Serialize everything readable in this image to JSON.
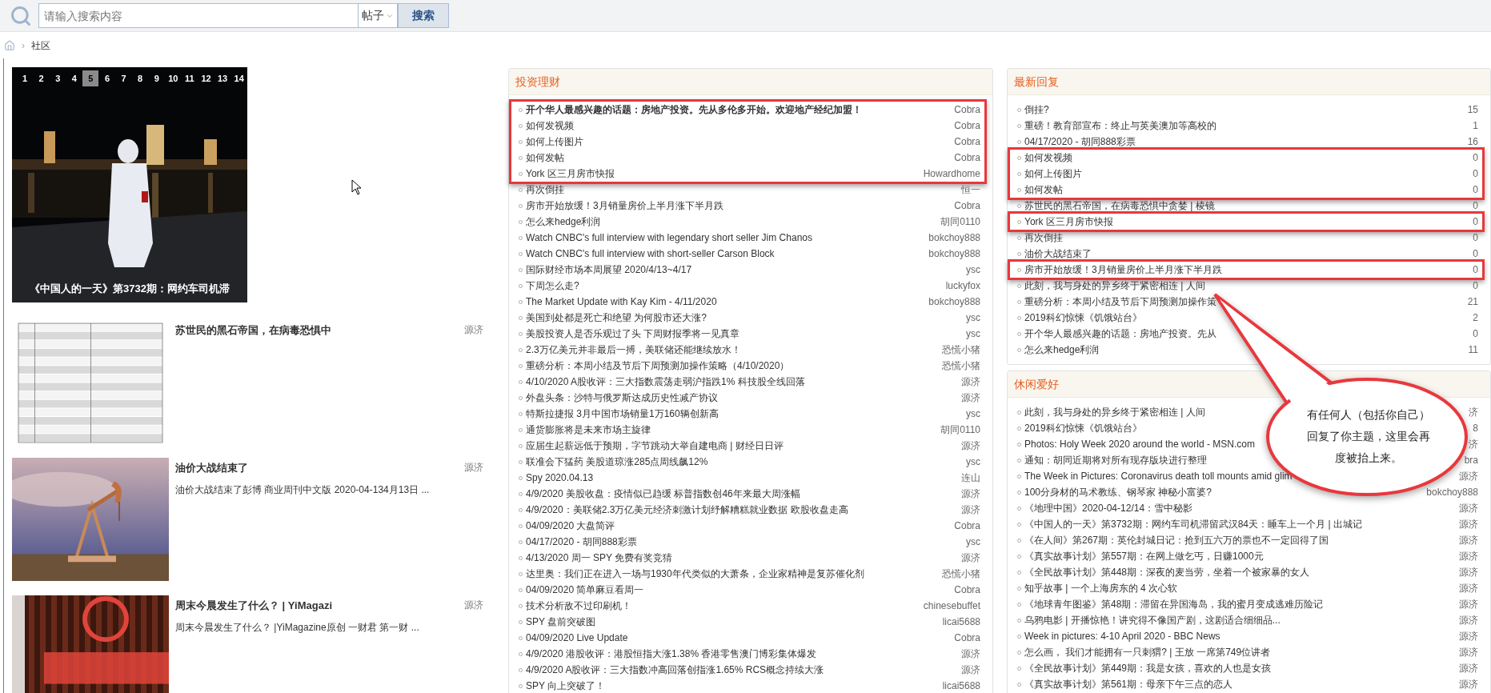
{
  "search": {
    "placeholder": "请输入搜索内容",
    "scope": "帖子",
    "button": "搜索"
  },
  "breadcrumb": {
    "separator": "›",
    "items": [
      "社区"
    ]
  },
  "slideshow": {
    "pages": [
      {
        "label": "1",
        "selected": false
      },
      {
        "label": "2",
        "selected": false
      },
      {
        "label": "3",
        "selected": false
      },
      {
        "label": "4",
        "selected": false
      },
      {
        "label": "5",
        "selected": true
      },
      {
        "label": "6",
        "selected": false
      },
      {
        "label": "7",
        "selected": false
      },
      {
        "label": "8",
        "selected": false
      },
      {
        "label": "9",
        "selected": false
      },
      {
        "label": "10",
        "selected": false
      },
      {
        "label": "11",
        "selected": false
      },
      {
        "label": "12",
        "selected": false
      },
      {
        "label": "13",
        "selected": false
      },
      {
        "label": "14",
        "selected": false
      }
    ],
    "caption": "《中国人的一天》第3732期：网约车司机滞"
  },
  "featured": [
    {
      "title": "苏世民的黑石帝国，在病毒恐惧中",
      "author": "源济"
    },
    {
      "title": "油价大战结束了",
      "author": "源济",
      "excerpt": "油价大战结束了彭博 商业周刊中文版 2020-04-134月13日 ..."
    },
    {
      "title": "周末今晨发生了什么？ | YiMagazi",
      "author": "源济",
      "excerpt": "周末今晨发生了什么？ |YiMagazine原创 一财君 第一财 ..."
    }
  ],
  "panels": [
    {
      "title": "投资理财",
      "rows": [
        {
          "title": "开个华人最感兴趣的话题：房地产投资。先从多伦多开始。欢迎地产经纪加盟！",
          "author": "Cobra",
          "bold": true,
          "highlighted": true
        },
        {
          "title": "如何发视频",
          "author": "Cobra",
          "bold": false,
          "highlighted": true
        },
        {
          "title": "如何上传图片",
          "author": "Cobra",
          "bold": false,
          "highlighted": true
        },
        {
          "title": "如何发帖",
          "author": "Cobra",
          "bold": false,
          "highlighted": true
        },
        {
          "title": "York 区三月房市快报",
          "author": "Howardhome",
          "bold": false,
          "highlighted": true
        },
        {
          "title": "再次倒挂",
          "author": "恒一",
          "bold": false,
          "highlighted": false
        },
        {
          "title": "房市开始放缓！3月销量房价上半月涨下半月跌",
          "author": "Cobra",
          "bold": false,
          "highlighted": false
        },
        {
          "title": "怎么来hedge利润",
          "author": "胡同0110",
          "bold": false,
          "highlighted": false
        },
        {
          "title": "Watch CNBC's full interview with legendary short seller Jim Chanos",
          "author": "bokchoy888",
          "bold": false,
          "highlighted": false
        },
        {
          "title": "Watch CNBC's full interview with short-seller Carson Block",
          "author": "bokchoy888",
          "bold": false,
          "highlighted": false
        },
        {
          "title": "国际财经市场本周展望 2020/4/13~4/17",
          "author": "ysc",
          "bold": false,
          "highlighted": false
        },
        {
          "title": "下周怎么走?",
          "author": "luckyfox",
          "bold": false,
          "highlighted": false
        },
        {
          "title": "The Market Update with Kay Kim - 4/11/2020",
          "author": "bokchoy888",
          "bold": false,
          "highlighted": false
        },
        {
          "title": "美国到处都是死亡和绝望 为何股市还大涨?",
          "author": "ysc",
          "bold": false,
          "highlighted": false
        },
        {
          "title": "美股投资人是否乐观过了头 下周财报季将一见真章",
          "author": "ysc",
          "bold": false,
          "highlighted": false
        },
        {
          "title": "2.3万亿美元并非最后一搏，美联储还能继续放水！",
          "author": "恐慌小猪",
          "bold": false,
          "highlighted": false
        },
        {
          "title": "重磅分析：本周小结及节后下周预测加操作策略（4/10/2020）",
          "author": "恐慌小猪",
          "bold": false,
          "highlighted": false
        },
        {
          "title": "4/10/2020 A股收评：三大指数震荡走弱沪指跌1% 科技股全线回落",
          "author": "源济",
          "bold": false,
          "highlighted": false
        },
        {
          "title": "外盘头条：沙特与俄罗斯达成历史性减产协议",
          "author": "源济",
          "bold": false,
          "highlighted": false
        },
        {
          "title": "特斯拉捷报 3月中国市场销量1万160辆创新高",
          "author": "ysc",
          "bold": false,
          "highlighted": false
        },
        {
          "title": "通货膨胀将是未来市场主旋律",
          "author": "胡同0110",
          "bold": false,
          "highlighted": false
        },
        {
          "title": "应届生起薪远低于预期，字节跳动大举自建电商 | 财经日日评",
          "author": "源济",
          "bold": false,
          "highlighted": false
        },
        {
          "title": "联准会下猛药 美股道琼涨285点周线飙12%",
          "author": "ysc",
          "bold": false,
          "highlighted": false
        },
        {
          "title": "Spy 2020.04.13",
          "author": "连山",
          "bold": false,
          "highlighted": false
        },
        {
          "title": "4/9/2020 美股收盘：疫情似已趋缓 标普指数创46年来最大周涨幅",
          "author": "源济",
          "bold": false,
          "highlighted": false
        },
        {
          "title": "4/9/2020：美联储2.3万亿美元经济刺激计划纾解糟糕就业数据 欧股收盘走高",
          "author": "源济",
          "bold": false,
          "highlighted": false
        },
        {
          "title": "04/09/2020 大盘简评",
          "author": "Cobra",
          "bold": false,
          "highlighted": false
        },
        {
          "title": "04/17/2020 - 胡同888彩票",
          "author": "ysc",
          "bold": false,
          "highlighted": false
        },
        {
          "title": "4/13/2020 周一 SPY 免费有奖竞猜",
          "author": "源济",
          "bold": false,
          "highlighted": false
        },
        {
          "title": "达里奥：我们正在进入一场与1930年代类似的大萧条，企业家精神是复苏催化剂",
          "author": "恐慌小猪",
          "bold": false,
          "highlighted": false
        },
        {
          "title": "04/09/2020 简单麻豆看周一",
          "author": "Cobra",
          "bold": false,
          "highlighted": false
        },
        {
          "title": "技术分析敌不过印刷机！",
          "author": "chinesebuffet",
          "bold": false,
          "highlighted": false
        },
        {
          "title": "SPY 盘前突破图",
          "author": "licai5688",
          "bold": false,
          "highlighted": false
        },
        {
          "title": "04/09/2020 Live Update",
          "author": "Cobra",
          "bold": false,
          "highlighted": false
        },
        {
          "title": "4/9/2020 港股收评：港股恒指大涨1.38% 香港零售澳门博彩集体爆发",
          "author": "源济",
          "bold": false,
          "highlighted": false
        },
        {
          "title": "4/9/2020 A股收评：三大指数冲高回落创指涨1.65% RCS概念持续大涨",
          "author": "源济",
          "bold": false,
          "highlighted": false
        },
        {
          "title": "SPY 向上突破了！",
          "author": "licai5688",
          "bold": false,
          "highlighted": false
        }
      ]
    },
    {
      "title": "最新回复",
      "rows": [
        {
          "title": "倒挂?",
          "count": "15",
          "highlighted": false
        },
        {
          "title": "重磅！教育部宣布：终止与英美澳加等高校的",
          "count": "1",
          "highlighted": false
        },
        {
          "title": "04/17/2020 - 胡同888彩票",
          "count": "16",
          "highlighted": false
        },
        {
          "title": "如何发视频",
          "count": "0",
          "highlighted": true
        },
        {
          "title": "如何上传图片",
          "count": "0",
          "highlighted": true
        },
        {
          "title": "如何发帖",
          "count": "0",
          "highlighted": true
        },
        {
          "title": "苏世民的黑石帝国，在病毒恐惧中贪婪 | 棱镜",
          "count": "0",
          "highlighted": false
        },
        {
          "title": "York 区三月房市快报",
          "count": "0",
          "highlighted": true
        },
        {
          "title": "再次倒挂",
          "count": "0",
          "highlighted": false
        },
        {
          "title": "油价大战结束了",
          "count": "0",
          "highlighted": false
        },
        {
          "title": "房市开始放缓！3月销量房价上半月涨下半月跌",
          "count": "0",
          "highlighted": true
        },
        {
          "title": "此刻，我与身处的异乡终于紧密相连 | 人间",
          "count": "0",
          "highlighted": false
        },
        {
          "title": "重磅分析：本周小结及节后下周预测加操作策",
          "count": "21",
          "highlighted": false
        },
        {
          "title": "2019科幻惊悚《饥饿站台》",
          "count": "2",
          "highlighted": false
        },
        {
          "title": "开个华人最感兴趣的话题：房地产投资。先从",
          "count": "0",
          "highlighted": false
        },
        {
          "title": "怎么来hedge利润",
          "count": "11",
          "highlighted": false
        }
      ]
    },
    {
      "title": "休闲爱好",
      "rows": [
        {
          "title": "此刻，我与身处的异乡终于紧密相连 | 人间",
          "author": "济"
        },
        {
          "title": "2019科幻惊悚《饥饿站台》",
          "author": "8"
        },
        {
          "title": "Photos: Holy Week 2020 around the world - MSN.com",
          "author": "济"
        },
        {
          "title": "通知：胡同近期将对所有现存版块进行整理",
          "author": "bra"
        },
        {
          "title": "The Week in Pictures: Coronavirus death toll mounts amid glim",
          "author": "源济"
        },
        {
          "title": "100分身材的马术教练、钢琴家 神秘小富婆?",
          "author": "bokchoy888"
        },
        {
          "title": "《地理中国》2020-04-12/14：雪中秘影",
          "author": "源济"
        },
        {
          "title": "《中国人的一天》第3732期：网约车司机滞留武汉84天：睡车上一个月 | 出城记",
          "author": "源济"
        },
        {
          "title": "《在人间》第267期：英伦封城日记：抢到五六万的票也不一定回得了国",
          "author": "源济"
        },
        {
          "title": "《真实故事计划》第557期：在网上做乞丐，日赚1000元",
          "author": "源济"
        },
        {
          "title": "《全民故事计划》第448期：深夜的麦当劳，坐着一个被家暴的女人",
          "author": "源济"
        },
        {
          "title": "知乎故事 | 一个上海房东的 4 次心软",
          "author": "源济"
        },
        {
          "title": "《地球青年图鉴》第48期：滞留在异国海岛，我的蜜月变成逃难历险记",
          "author": "源济"
        },
        {
          "title": "乌鸦电影 | 开播惊艳！讲究得不像国产剧，这剧适合细细品...",
          "author": "源济"
        },
        {
          "title": "Week in pictures: 4-10 April 2020 - BBC News",
          "author": "源济"
        },
        {
          "title": "怎么画， 我们才能拥有一只刺猬? | 王放 一席第749位讲者",
          "author": "源济"
        },
        {
          "title": "《全民故事计划》第449期：我是女孩，喜欢的人也是女孩",
          "author": "源济"
        },
        {
          "title": "《真实故事计划》第561期：母亲下午三点的恋人",
          "author": "源济"
        }
      ]
    }
  ],
  "callout": {
    "text": "有任何人（包括你自己）回复了你主题，这里会再度被抬上来。"
  }
}
